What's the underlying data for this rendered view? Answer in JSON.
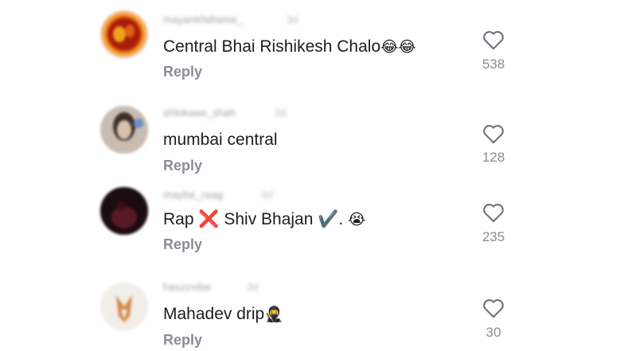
{
  "comments": [
    {
      "username": "mayankfaftame_",
      "age": "3d",
      "text": "Central Bhai Rishikesh Chalo",
      "emoji": "😂😂",
      "reply_label": "Reply",
      "likes": "538",
      "avatar_icon": "avatar-flame-photo",
      "avatar_colors": [
        "#f7c8d8",
        "#c7260d",
        "#f2a321"
      ]
    },
    {
      "username": "shlokaaa_shah",
      "age": "3d",
      "text": "mumbai central",
      "emoji": "",
      "reply_label": "Reply",
      "likes": "128",
      "avatar_icon": "avatar-person-photo",
      "avatar_colors": [
        "#3b2f2b",
        "#b6a396",
        "#6a8fc2"
      ]
    },
    {
      "username": "maybe_raag",
      "age": "3d",
      "text": "Rap ❌ Shiv Bhajan ✔️.",
      "emoji": "😭",
      "reply_label": "Reply",
      "likes": "235",
      "avatar_icon": "avatar-dark-photo",
      "avatar_colors": [
        "#1a0c10",
        "#5a1a24"
      ]
    },
    {
      "username": "haszzvibe",
      "age": "3d",
      "text": "Mahadev drip",
      "emoji": "🥷",
      "reply_label": "Reply",
      "likes": "30",
      "avatar_icon": "avatar-fox-illustration",
      "avatar_colors": [
        "#f1ede8",
        "#d38a45"
      ]
    }
  ],
  "like_icon": "heart-outline-icon"
}
